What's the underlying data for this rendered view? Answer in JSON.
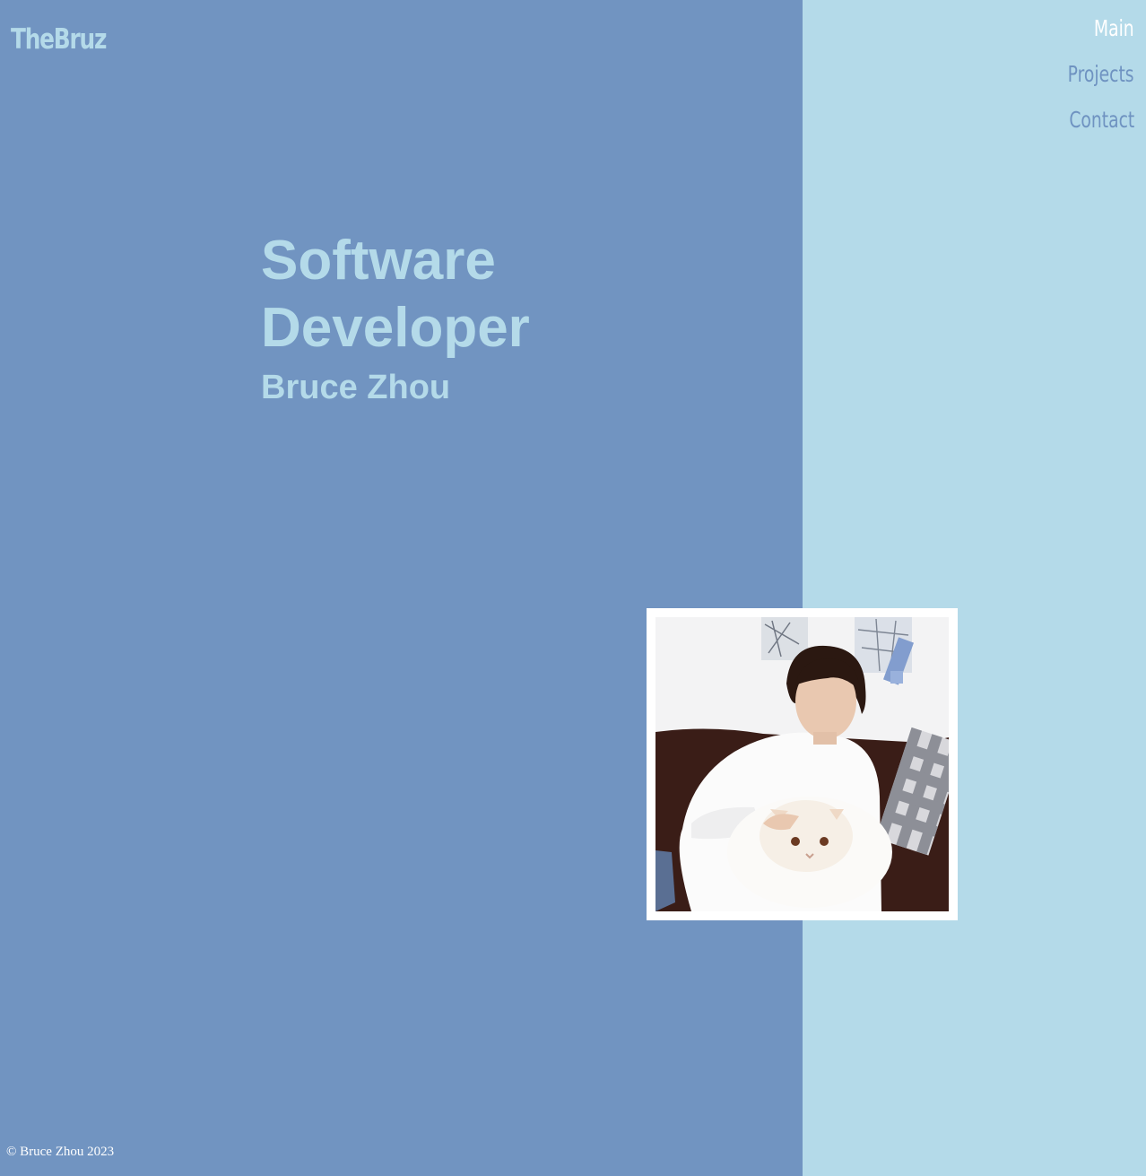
{
  "brand": {
    "logo_text": "TheBruz"
  },
  "nav": {
    "items": [
      {
        "label": "Main",
        "active": true
      },
      {
        "label": "Projects",
        "active": false
      },
      {
        "label": "Contact",
        "active": false
      }
    ]
  },
  "hero": {
    "title_line1": "Software",
    "title_line2": "Developer",
    "name": "Bruce Zhou"
  },
  "footer": {
    "copyright": "© Bruce Zhou 2023"
  },
  "colors": {
    "left_panel": "#7194c1",
    "right_panel": "#b4dae9",
    "accent_text": "#b4dae9",
    "nav_text": "#6f93c1",
    "nav_active": "#ffffff"
  }
}
